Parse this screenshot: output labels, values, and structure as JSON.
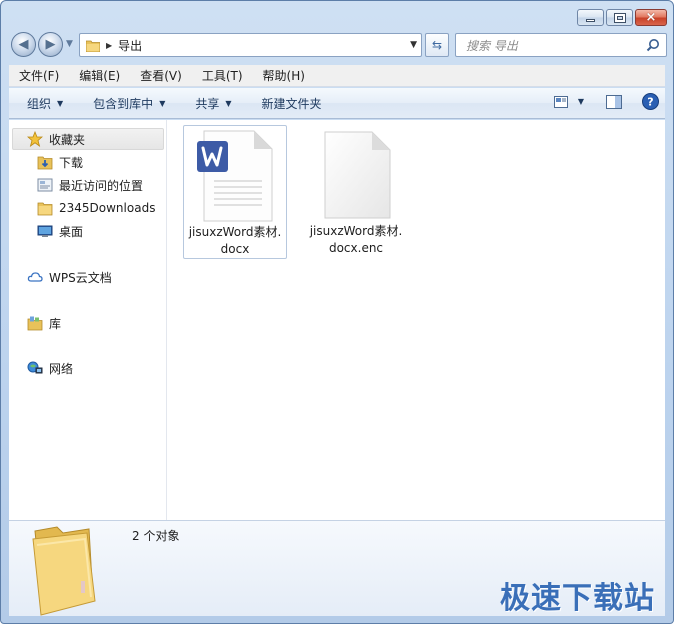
{
  "window": {
    "caption": {
      "minimize_glyph": "minimize-icon",
      "maximize_glyph": "maximize-icon",
      "close_glyph": "×"
    }
  },
  "address": {
    "path": "导出",
    "search_placeholder": "搜索 导出"
  },
  "menu": [
    {
      "label": "文件(F)"
    },
    {
      "label": "编辑(E)"
    },
    {
      "label": "查看(V)"
    },
    {
      "label": "工具(T)"
    },
    {
      "label": "帮助(H)"
    }
  ],
  "toolbar": {
    "organize": "组织",
    "include_in_library": "包含到库中",
    "share": "共享",
    "new_folder": "新建文件夹"
  },
  "nav": {
    "favorites": "收藏夹",
    "downloads": "下载",
    "recent_places": "最近访问的位置",
    "downloads_2345": "2345Downloads",
    "desktop": "桌面",
    "wps_cloud": "WPS云文档",
    "library": "库",
    "network": "网络"
  },
  "files": [
    {
      "name_line1": "jisuxzWord素材.",
      "name_line2": "docx",
      "type": "wps-word-document-icon"
    },
    {
      "name_line1": "jisuxzWord素材.",
      "name_line2": "docx.enc",
      "type": "blank-document-icon"
    }
  ],
  "details": {
    "count_text": "2 个对象"
  },
  "watermark": "极速下载站",
  "colors": {
    "accent": "#3a6fb8",
    "wps_badge": "#3d5ba6",
    "folder_yellow": "#e8c25a"
  }
}
